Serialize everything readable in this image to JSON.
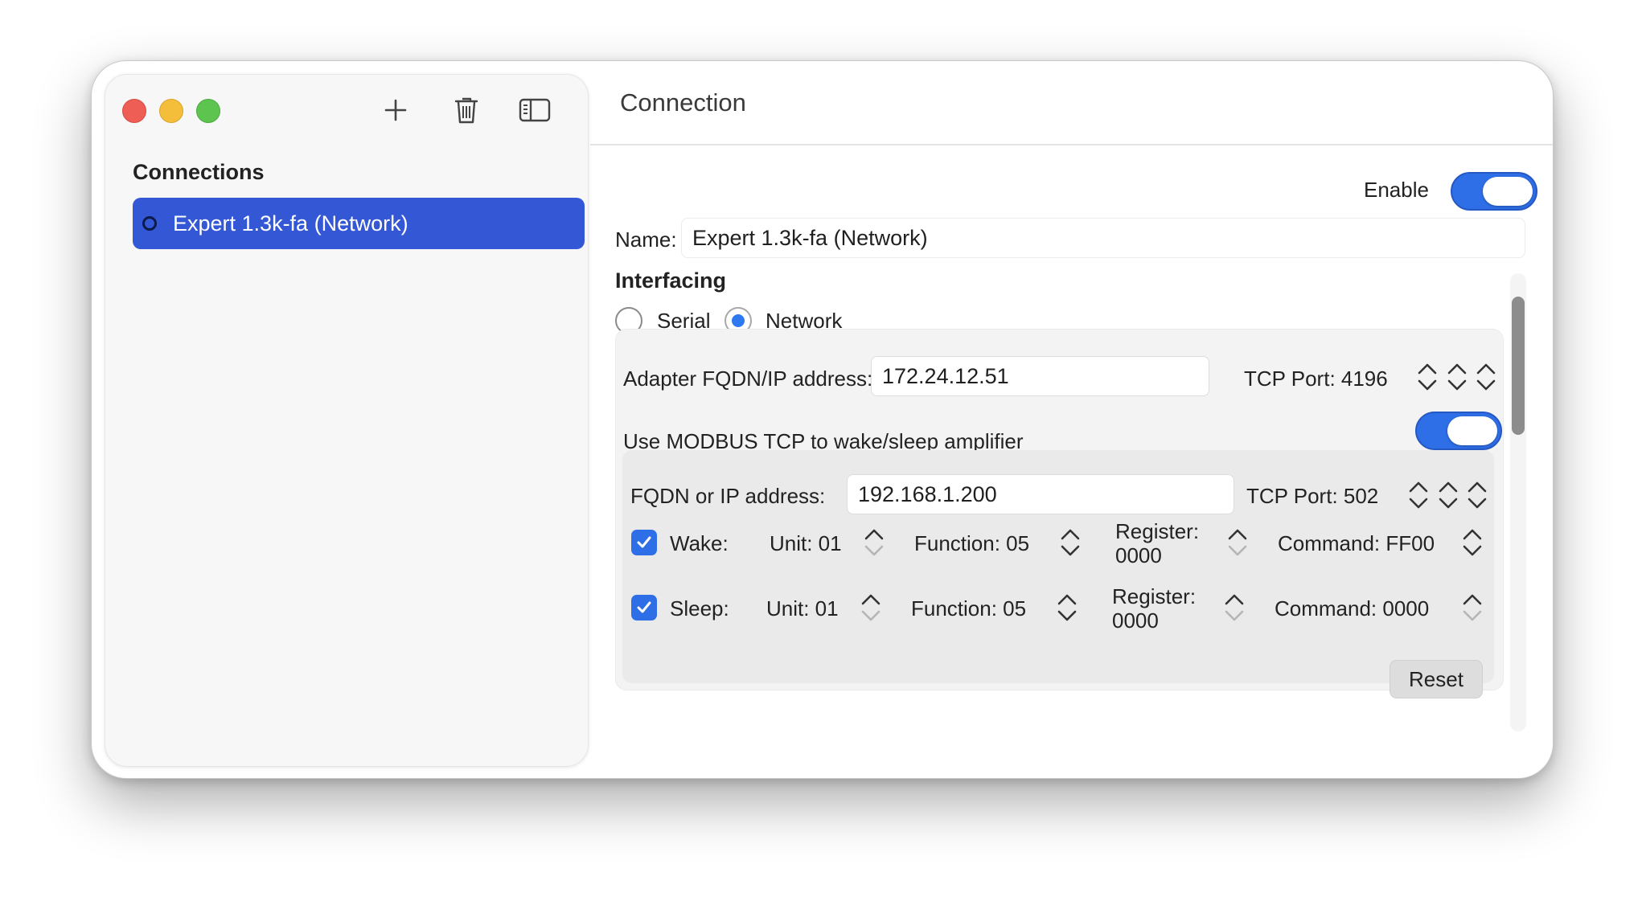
{
  "toolbar": {
    "add_icon": "plus-icon",
    "delete_icon": "trash-icon",
    "sidebar_toggle_icon": "sidebar-toggle-icon"
  },
  "sidebar": {
    "title": "Connections",
    "items": [
      {
        "label": "Expert 1.3k-fa (Network)",
        "selected": true
      }
    ]
  },
  "main": {
    "title": "Connection",
    "enable": {
      "label": "Enable",
      "on": true
    },
    "name": {
      "label": "Name:",
      "value": "Expert 1.3k-fa (Network)"
    },
    "interfacing": {
      "title": "Interfacing",
      "options": [
        "Serial",
        "Network"
      ],
      "selected": "Network"
    },
    "adapter": {
      "label": "Adapter FQDN/IP address:",
      "value": "172.24.12.51",
      "port_label": "TCP Port: 4196"
    },
    "modbus": {
      "label": "Use MODBUS TCP to wake/sleep amplifier",
      "on": true,
      "address_label": "FQDN or IP address:",
      "address_value": "192.168.1.200",
      "port_label": "TCP Port: 502",
      "wake": {
        "label": "Wake:",
        "checked": true,
        "unit": "Unit: 01",
        "function": "Function: 05",
        "register_line1": "Register:",
        "register_line2": "0000",
        "command": "Command: FF00"
      },
      "sleep": {
        "label": "Sleep:",
        "checked": true,
        "unit": "Unit: 01",
        "function": "Function: 05",
        "register_line1": "Register:",
        "register_line2": "0000",
        "command": "Command: 0000"
      },
      "reset_label": "Reset"
    }
  },
  "colors": {
    "accent": "#3457d6",
    "toggle_on": "#2e6fe8",
    "close": "#ee5e55",
    "minimize": "#f5be3a",
    "maximize": "#5dc44f"
  }
}
